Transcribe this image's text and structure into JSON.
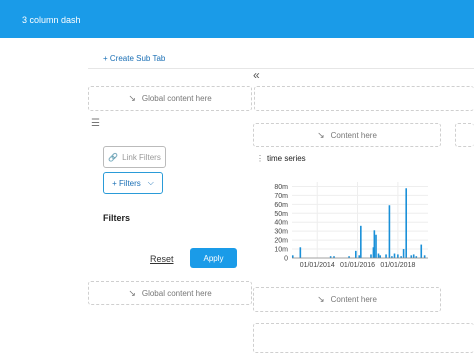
{
  "header": {
    "title": "3 column dash"
  },
  "toolbar": {
    "create_sub_tab": "+ Create Sub Tab",
    "collapse_glyph": "«"
  },
  "placeholders": {
    "global_top": "Global content here",
    "content_top": "Content here",
    "global_bottom": "Global content here",
    "content_bottom": "Content here"
  },
  "filters": {
    "link_filters_label": "Link Filters",
    "add_filters_label": "+ Filters",
    "title": "Filters",
    "reset_label": "Reset",
    "apply_label": "Apply"
  },
  "chart_panel": {
    "title": "time series"
  },
  "chart_data": {
    "type": "bar",
    "title": "time series",
    "xlabel": "",
    "ylabel": "",
    "x_ticks": [
      "01/01/2014",
      "01/01/2016",
      "01/01/2018"
    ],
    "y_ticks": [
      "0",
      "10m",
      "20m",
      "30m",
      "40m",
      "50m",
      "60m",
      "70m",
      "80m"
    ],
    "ylim": [
      0,
      85
    ],
    "xlim": [
      "2012-10-01",
      "2019-07-01"
    ],
    "color": "#1a90d8",
    "x": [
      "2012-10-15",
      "2013-03-01",
      "2014-09-01",
      "2014-11-01",
      "2015-08-01",
      "2015-12-01",
      "2016-02-01",
      "2016-03-01",
      "2016-09-01",
      "2016-10-15",
      "2016-11-01",
      "2016-12-01",
      "2017-01-15",
      "2017-02-15",
      "2017-06-01",
      "2017-08-01",
      "2017-09-15",
      "2017-11-01",
      "2018-01-01",
      "2018-03-01",
      "2018-04-15",
      "2018-06-01",
      "2018-09-01",
      "2018-10-15",
      "2018-12-01",
      "2019-03-01",
      "2019-05-01"
    ],
    "values": [
      3,
      12,
      2,
      2,
      2,
      8,
      3,
      36,
      4,
      12,
      31,
      26,
      5,
      3,
      4,
      59,
      2,
      5,
      4,
      2,
      10,
      78,
      3,
      4,
      2,
      15,
      3
    ]
  }
}
